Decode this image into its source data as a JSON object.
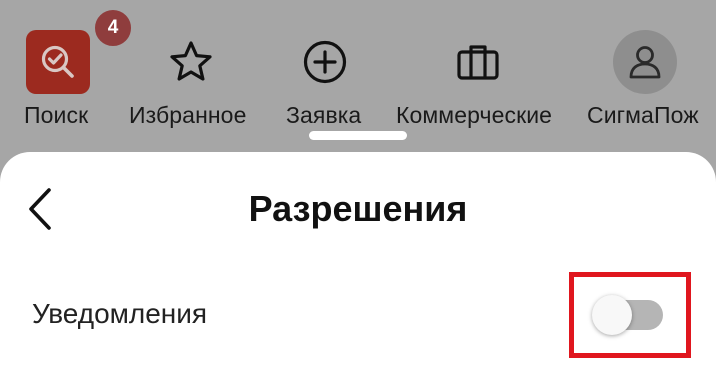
{
  "tabbar": {
    "tabs": [
      {
        "label": "Поиск",
        "icon": "search-icon",
        "badge": "4"
      },
      {
        "label": "Избранное",
        "icon": "star-icon"
      },
      {
        "label": "Заявка",
        "icon": "plus-circle-icon"
      },
      {
        "label": "Коммерческие",
        "icon": "briefcase-icon"
      },
      {
        "label": "СигмаПож",
        "icon": "user-icon"
      }
    ]
  },
  "sheet": {
    "title": "Разрешения",
    "back_icon": "chevron-left-icon",
    "settings": [
      {
        "label": "Уведомления",
        "enabled": false
      }
    ]
  },
  "colors": {
    "overlay_background": "#a6a6a6",
    "search_tile": "#9c2a1f",
    "badge": "#8f3d3d",
    "highlight_border": "#e0161e",
    "toggle_off_track": "#b5b5b5"
  }
}
